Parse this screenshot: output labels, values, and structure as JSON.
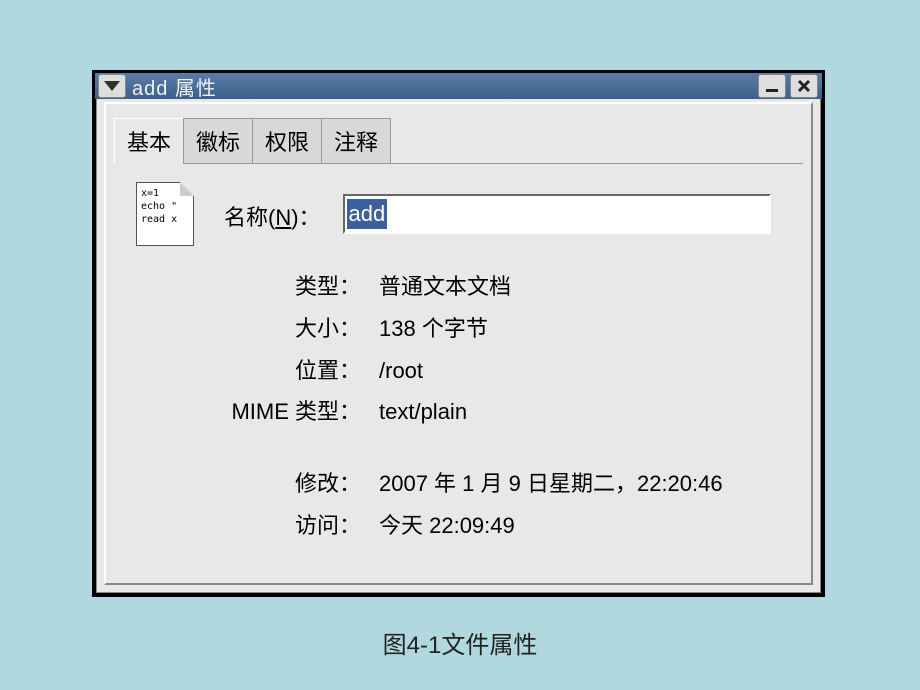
{
  "window": {
    "title": "add  属性"
  },
  "tabs": [
    "基本",
    "徽标",
    "权限",
    "注释"
  ],
  "fileIcon": {
    "line1": "x=1",
    "line2": "echo \"",
    "line3": "read x"
  },
  "fields": {
    "name": {
      "label_prefix": "名称(",
      "label_underline": "N",
      "label_suffix": ")：",
      "value": "add"
    },
    "type": {
      "label": "类型：",
      "value": "普通文本文档"
    },
    "size": {
      "label": "大小：",
      "value": "138 个字节"
    },
    "location": {
      "label": "位置：",
      "value": "/root"
    },
    "mime": {
      "label": "MIME 类型：",
      "value": "text/plain"
    },
    "modified": {
      "label": "修改：",
      "value": "2007 年  1 月 9 日星期二，22:20:46"
    },
    "accessed": {
      "label": "访问：",
      "value": "今天 22:09:49"
    }
  },
  "caption": "图4-1文件属性"
}
